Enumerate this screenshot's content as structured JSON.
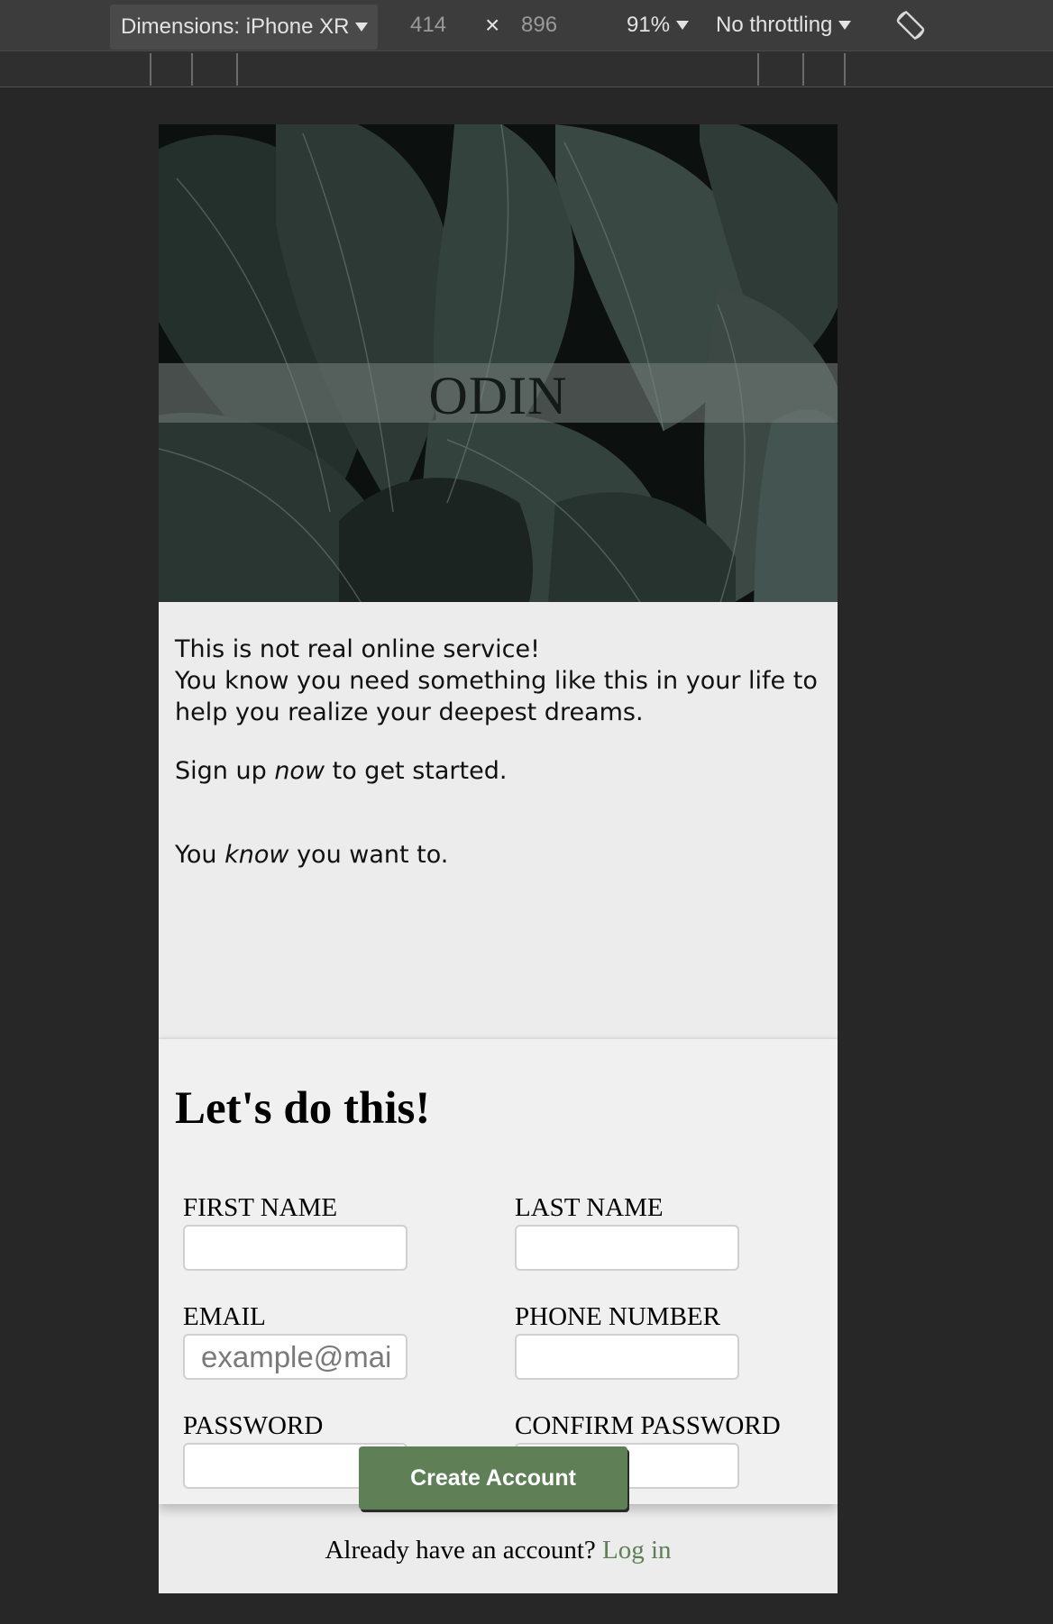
{
  "devtools": {
    "device_label": "Dimensions: iPhone XR",
    "width_value": "414",
    "times_symbol": "×",
    "height_value": "896",
    "zoom": "91%",
    "throttling": "No throttling",
    "rotate_icon": "rotate-icon"
  },
  "hero": {
    "logo": "ODIN"
  },
  "intro": {
    "line1": "This is not real online service!",
    "line2": "You know you need something like this in your life to help you realize your deepest dreams.",
    "signup_pre": "Sign up ",
    "signup_em": "now",
    "signup_post": " to get started.",
    "know_pre": "You ",
    "know_em": "know",
    "know_post": " you want to."
  },
  "form": {
    "title": "Let's do this!",
    "first_name_label": "FIRST NAME",
    "last_name_label": "LAST NAME",
    "email_label": "EMAIL",
    "email_placeholder": "example@mail.com",
    "phone_label": "PHONE NUMBER",
    "password_label": "PASSWORD",
    "confirm_password_label": "CONFIRM PASSWORD"
  },
  "actions": {
    "create_account": "Create Account",
    "login_prompt": "Already have an account? ",
    "login_link": "Log in"
  },
  "colors": {
    "accent": "#5f7f57",
    "page_bg": "#272727",
    "viewport_bg": "#ececec",
    "card_bg": "#f0f0f0"
  }
}
